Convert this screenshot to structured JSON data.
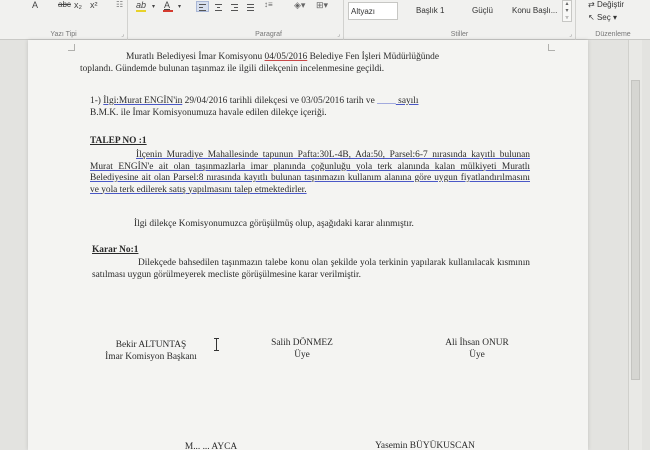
{
  "ribbon": {
    "font_group": {
      "label": "Yazı Tipi",
      "buttons": [
        "A",
        "abc",
        "x₂",
        "x²",
        "A"
      ],
      "highlight_color": "#e8d22a",
      "font_color": "#d43b2f"
    },
    "paragraph_group": {
      "label": "Paragraf"
    },
    "styles_group": {
      "label": "Stiller",
      "styles": [
        "Altyazı",
        "Başlık 1",
        "Güçlü",
        "Konu Başlı..."
      ]
    },
    "editing_group": {
      "label": "Düzenleme",
      "items": [
        "Değiştir",
        "Seç"
      ]
    }
  },
  "document": {
    "intro": {
      "line1_a": "Muratlı Belediyesi İmar Komisyonu ",
      "date1": "04/05/2016",
      "line1_b": " Belediye Fen İşleri Müdürlüğünde",
      "line2": "toplandı. Gündemde bulunan taşınmaz ile ilgili dilekçenin incelenmesine geçildi."
    },
    "item1": {
      "prefix": "1-) ",
      "name": "İlgi:Murat  ENGİN'in",
      "line1_rest": " 29/04/2016 tarihli dilekçesi ve 03/05/2016 tarih ve ",
      "blank": "____",
      "sayili": " sayılı",
      "line2": "B.M.K. ile İmar Komisyonumuza havale edilen dilekçe içeriği."
    },
    "talep": {
      "heading": "TALEP NO          :1",
      "body": "İlçenin Muradiye Mahallesinde tapunun Pafta:30L-4B, Ada:50, Parsel:6-7 nırasında kayıtlı bulunan Murat ENGİN'e ait olan taşınmazlarla imar planında çoğunluğu yola terk alanında kalan mülkiyeti Muratlı Belediyesine ait olan Parsel:8 nırasında kayıtlı bulunan taşınmazın kullanım alanına göre uygun fiyatlandırılmasını ve yola terk edilerek satış yapılmasını talep etmektedirler.",
      "note": "İlgi dilekçe Komisyonumuzca görüşülmüş olup, aşağıdaki karar alınmıştır."
    },
    "karar": {
      "heading": "Karar No:1",
      "body": "Dilekçede bahsedilen taşınmazın talebe konu olan şekilde yola terkinin yapılarak kullanılacak kısmının satılması uygun görülmeyerek mecliste görüşülmesine karar verilmiştir."
    },
    "signatures": [
      {
        "name": "Bekir ALTUNTAŞ",
        "role": "İmar Komisyon Başkanı"
      },
      {
        "name": "Salih DÖNMEZ",
        "role": "Üye"
      },
      {
        "name": "Ali İhsan ONUR",
        "role": "Üye"
      }
    ],
    "bottom_cut": {
      "left": "M... ... AYCA",
      "right": "Yasemin BÜYÜKUSCAN"
    }
  }
}
